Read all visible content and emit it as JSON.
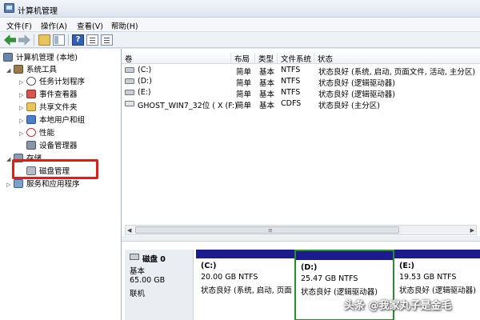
{
  "window": {
    "title": "计算机管理"
  },
  "menu": [
    "文件(F)",
    "操作(A)",
    "查看(V)",
    "帮助(H)"
  ],
  "toolbar": {
    "icons": [
      "back-icon",
      "forward-icon",
      "folder-up-icon",
      "show-hide-tree-icon",
      "help-icon",
      "properties-icon"
    ]
  },
  "tree": {
    "root": "计算机管理 (本地)",
    "system_tools": "系统工具",
    "task_scheduler": "任务计划程序",
    "event_viewer": "事件查看器",
    "shared_folders": "共享文件夹",
    "local_users": "本地用户和组",
    "performance": "性能",
    "device_manager": "设备管理器",
    "storage": "存储",
    "disk_management": "磁盘管理",
    "services": "服务和应用程序"
  },
  "volume_list": {
    "columns": [
      "卷",
      "布局",
      "类型",
      "文件系统",
      "状态"
    ],
    "rows": [
      {
        "volume": "(C:)",
        "layout": "简单",
        "type": "基本",
        "fs": "NTFS",
        "status": "状态良好 (系统, 启动, 页面文件, 活动, 主分区)"
      },
      {
        "volume": "(D:)",
        "layout": "简单",
        "type": "基本",
        "fs": "NTFS",
        "status": "状态良好 (逻辑驱动器)"
      },
      {
        "volume": "(E:)",
        "layout": "简单",
        "type": "基本",
        "fs": "NTFS",
        "status": "状态良好 (逻辑驱动器)"
      },
      {
        "volume": "GHOST_WIN7_32位 ( X (F:)",
        "layout": "简单",
        "type": "基本",
        "fs": "CDFS",
        "status": "状态良好 (主分区)"
      }
    ]
  },
  "scrollbar": {
    "grip": "≡"
  },
  "disk": {
    "name": "磁盘 0",
    "type": "基本",
    "size": "65.00 GB",
    "state": "联机",
    "partitions": [
      {
        "letter": "(C:)",
        "size": "20.00 GB NTFS",
        "status": "状态良好 (系统, 启动, 页面"
      },
      {
        "letter": "(D:)",
        "size": "25.47 GB NTFS",
        "status": "状态良好 (逻辑驱动器)"
      },
      {
        "letter": "(E:)",
        "size": "19.53 GB NTFS",
        "status": "状态良好 (逻辑驱动器)"
      }
    ]
  },
  "watermark": "头条 @我家丸子是金毛"
}
